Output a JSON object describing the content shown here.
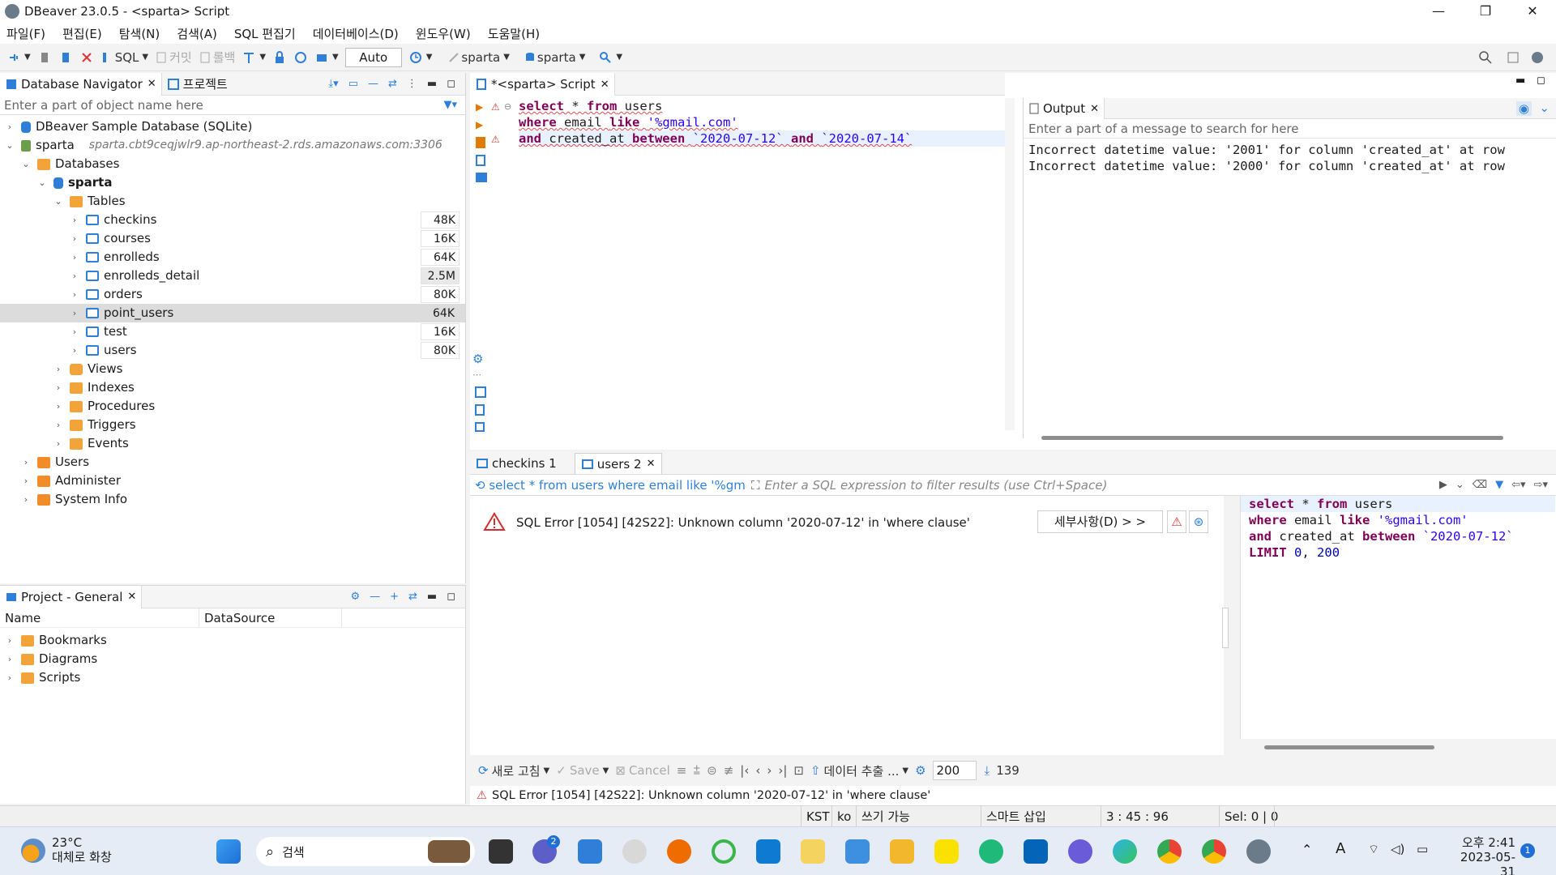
{
  "window": {
    "title": "DBeaver 23.0.5 - <sparta> Script",
    "minimize": "—",
    "maximize": "❐",
    "close": "✕"
  },
  "menu": [
    "파일(F)",
    "편집(E)",
    "탐색(N)",
    "검색(A)",
    "SQL 편집기",
    "데이터베이스(D)",
    "윈도우(W)",
    "도움말(H)"
  ],
  "toolbar": {
    "sql_label": "SQL",
    "commit_label": "커밋",
    "rollback_label": "롤백",
    "auto_label": "Auto",
    "datasource": "sparta",
    "schema": "sparta"
  },
  "db_navigator": {
    "tab_label": "Database Navigator",
    "project_tab_label": "프로젝트",
    "filter_placeholder": "Enter a part of object name here",
    "tree": {
      "sample_db": "DBeaver Sample Database (SQLite)",
      "sparta_conn": "sparta",
      "sparta_host": "sparta.cbt9ceqjwlr9.ap-northeast-2.rds.amazonaws.com:3306",
      "databases": "Databases",
      "sparta_db": "sparta",
      "tables": "Tables",
      "table_items": [
        {
          "name": "checkins",
          "size": "48K"
        },
        {
          "name": "courses",
          "size": "16K"
        },
        {
          "name": "enrolleds",
          "size": "64K"
        },
        {
          "name": "enrolleds_detail",
          "size": "2.5M"
        },
        {
          "name": "orders",
          "size": "80K"
        },
        {
          "name": "point_users",
          "size": "64K"
        },
        {
          "name": "test",
          "size": "16K"
        },
        {
          "name": "users",
          "size": "80K"
        }
      ],
      "views": "Views",
      "indexes": "Indexes",
      "procedures": "Procedures",
      "triggers": "Triggers",
      "events": "Events",
      "users": "Users",
      "administer": "Administer",
      "system_info": "System Info"
    }
  },
  "project_panel": {
    "tab_label": "Project - General",
    "col_name": "Name",
    "col_datasource": "DataSource",
    "items": [
      "Bookmarks",
      "Diagrams",
      "Scripts"
    ]
  },
  "editor": {
    "tab_label": "*<sparta> Script",
    "lines": [
      {
        "kw1": "select",
        "rest1": " * ",
        "kw2": "from",
        "rest2": " users",
        "s": ""
      },
      {
        "kw1": "where",
        "rest1": " email ",
        "kw2": "like",
        "rest2": " ",
        "s": "'%gmail.com'"
      },
      {
        "kw1": "and",
        "rest1": " created_at ",
        "kw2": "between",
        "rest2": " ",
        "s": "`2020-07-12`",
        "kw3": "and",
        "s2": "`2020-07-14`"
      }
    ]
  },
  "output": {
    "tab_label": "Output",
    "search_placeholder": "Enter a part of a message to search for here",
    "lines": [
      "Incorrect datetime value: '2001' for column 'created_at' at row",
      "Incorrect datetime value: '2000' for column 'created_at' at row"
    ]
  },
  "results": {
    "tabs": [
      "checkins 1",
      "users 2"
    ],
    "query_preview": "select * from users where email like '%gmail.",
    "filter_placeholder": "Enter a SQL expression to filter results (use Ctrl+Space)",
    "error_message": "SQL Error [1054] [42S22]: Unknown column '2020-07-12' in 'where clause'",
    "details_button": "세부사항(D) > >",
    "side_sql": {
      "l1_kw1": "select",
      "l1_rest": " * ",
      "l1_kw2": "from",
      "l1_rest2": " users",
      "l2_kw1": "where",
      "l2_rest": " email ",
      "l2_kw2": "like",
      "l2_s": " '%gmail.com'",
      "l3_kw1": "and",
      "l3_rest": " created_at ",
      "l3_kw2": "between",
      "l3_s": " `2020-07-12`",
      "l4_kw": "LIMIT",
      "l4_n1": "0",
      "l4_n2": "200"
    },
    "toolbar": {
      "refresh": "새로 고침",
      "save": "Save",
      "cancel": "Cancel",
      "export": "데이터 추출 ...",
      "fetch_size": "200",
      "row_count": "139"
    },
    "status": "SQL Error [1054] [42S22]: Unknown column '2020-07-12' in 'where clause'"
  },
  "statusbar": {
    "tz": "KST",
    "lang": "ko",
    "mode": "쓰기 가능",
    "insert": "스마트 삽입",
    "position": "3 : 45 : 96",
    "selection": "Sel: 0 | 0"
  },
  "taskbar": {
    "weather_temp": "23°C",
    "weather_desc": "대체로 화창",
    "search_label": "검색",
    "chat_badge": "2",
    "time": "오후 2:41",
    "date": "2023-05-31",
    "notif_count": "1"
  },
  "colors": {
    "keyword": "#7f0055",
    "string": "#2a00ff",
    "error_red": "#d32f2f",
    "accent_blue": "#2f7fd8"
  }
}
